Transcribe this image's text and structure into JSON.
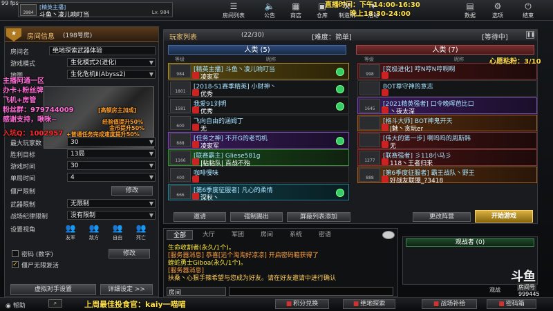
{
  "fps": "99 fps",
  "player": {
    "badge": "3984",
    "tag": "[精英主播]",
    "name": "斗鱼丶凌儿响叮当",
    "level": "Lv. 984"
  },
  "nav": [
    {
      "id": "rooms",
      "label": "房间列表",
      "icon": "☰"
    },
    {
      "id": "notice",
      "label": "公告",
      "icon": "🔈"
    },
    {
      "id": "shop",
      "label": "商店",
      "icon": "▦"
    },
    {
      "id": "depot",
      "label": "仓库",
      "icon": "▣"
    },
    {
      "id": "workshop",
      "label": "制造所",
      "icon": "⚒"
    },
    {
      "id": "event",
      "label": "活动",
      "icon": "✦"
    },
    {
      "id": "data",
      "label": "数据",
      "icon": "▤"
    },
    {
      "id": "options",
      "label": "选项",
      "icon": "⚙"
    },
    {
      "id": "exit",
      "label": "结束",
      "icon": "⏻"
    }
  ],
  "stream_time": {
    "line1": "直播时间：下午14:00-16:30",
    "line2": "晚上18:30-24:00"
  },
  "room": {
    "header": "房间信息",
    "number": "(198号房)",
    "fields": [
      {
        "label": "房间名",
        "value": "绝地探索武器体验"
      },
      {
        "label": "游戏模式",
        "value": "生化模式2(进化)"
      },
      {
        "label": "地图",
        "value": "生化危机Ⅱ(Abyss2)"
      }
    ],
    "settings": [
      {
        "label": "最大玩家数",
        "value": "30"
      },
      {
        "label": "胜利目标",
        "value": "13局"
      },
      {
        "label": "游戏时间",
        "value": "30"
      },
      {
        "label": "单局时间",
        "value": "4"
      },
      {
        "label": "僵尸限制",
        "value": "修改"
      },
      {
        "label": "武器限制",
        "value": "无限制"
      },
      {
        "label": "战场纪律限制",
        "value": "没有限制"
      }
    ],
    "view_label": "设置视角",
    "view_items": [
      "友军",
      "敌方",
      "自由",
      "死亡"
    ],
    "password_label": "密码 (数字)",
    "password_btn": "修改",
    "zombie_label": "僵尸无限复活",
    "btn_virtual": "虚拟对手设置",
    "btn_detail": "详细设定 >>"
  },
  "overlay": {
    "line1": "主播阿通一区",
    "line2": "办卡+粉丝牌",
    "line3": "飞机+房管",
    "line4": "粉丝群：979744009",
    "line5": "感谢支持，啾咪~",
    "qq": "入坑Q：1002957",
    "promo1": "[高额房主加成]",
    "promo2": "经验值提升50%",
    "promo3": "金币提升50%",
    "promo4": "+普通任务完成速度提升50%"
  },
  "players": {
    "title": "玩家列表",
    "count": "(22/30)",
    "difficulty": "[难度：简单]",
    "status": "[等待中]",
    "blue_title": "人类 (5)",
    "red_title": "人类 (7)",
    "col_level": "等级",
    "col_name": "昵称",
    "wish": "心愿粘粉：3/10",
    "blue": [
      {
        "lv": "984",
        "l1": "[精英主播] 斗鱼丶凌儿响叮当",
        "l2": "凌家军",
        "style": "bg-gold",
        "ready": true
      },
      {
        "lv": "1801",
        "l1": "[2018-S1赛季精英] 小财神丶",
        "l2": "优秀",
        "style": "",
        "ready": true
      },
      {
        "lv": "1581",
        "l1": "我爱91刘明",
        "l2": "优秀",
        "style": "",
        "ready": true
      },
      {
        "lv": "600",
        "l1": "飞向自由的涵姆丁",
        "l2": "无",
        "style": "",
        "ready": false
      },
      {
        "lv": "888",
        "l1": "[任务之神] 不开G的老司机",
        "l2": "凌家军",
        "style": "bg-purple",
        "ready": true
      },
      {
        "lv": "1166",
        "l1": "[联赛霸主] Gliese581g",
        "l2": "|粘粘队| 百战不殆",
        "style": "bg-green",
        "ready": false
      },
      {
        "lv": "400",
        "l1": "咖啡慢味",
        "l2": "",
        "style": "",
        "ready": false
      },
      {
        "lv": "666",
        "l1": "[第6季度征服者] 凡心的柔情",
        "l2": "深秋丶",
        "style": "bg-teal",
        "ready": true
      }
    ],
    "red": [
      {
        "lv": "998",
        "l1": "[究极进化] 哼N哼N哼啊啊",
        "l2": "",
        "style": "bg-darkred",
        "ready": false
      },
      {
        "lv": "",
        "l1": "BOT尊守神的意志",
        "l2": "",
        "style": "",
        "ready": false
      },
      {
        "lv": "1645",
        "l1": "[2021精英强者] 口令晚晖芭比口",
        "l2": "丶夜太深",
        "style": "bg-purple",
        "ready": false
      },
      {
        "lv": "",
        "l1": "[格斗大师] BOT神鬼开天",
        "l2": "|魅丶贪玩er",
        "style": "bg-orange",
        "ready": false
      },
      {
        "lv": "",
        "l1": "[伟大的第一步] 啊呜呜的周斯韩",
        "l2": "无",
        "style": "bg-darkred",
        "ready": false
      },
      {
        "lv": "1277",
        "l1": "[联赛强者] 彡118小马彡",
        "l2": "118丶王者归来",
        "style": "bg-darkred",
        "ready": false
      },
      {
        "lv": "888",
        "l1": "[第6季度征服者] 霸王战队丶野王",
        "l2": "好战友联盟_?3418",
        "style": "bg-orange",
        "ready": false
      }
    ],
    "btn_invite": "邀请",
    "btn_kick": "强制踢出",
    "btn_block": "屏蔽列表添加",
    "btn_change": "更改阵营",
    "btn_start": "开始游戏"
  },
  "chat": {
    "tabs": [
      "全部",
      "大厅",
      "军团",
      "房间",
      "系统",
      "密语"
    ],
    "messages": [
      {
        "text": "生命收割者(永久/1个)。",
        "color": "#ffeb3b"
      },
      {
        "text": "[服务器消息] 恭喜[远个淘淘好凉凉] 开启密码箱获得了",
        "color": "#ff9f3b"
      },
      {
        "text": "蝰蛇勇士Giboa(永久/1个)。",
        "color": "#ffeb3b"
      },
      {
        "text": "[服务器消息]",
        "color": "#ff9f3b"
      },
      {
        "text": "扶桑丶心狠手辣希望与您成为好友。请在好友邀请中进行确认",
        "color": "#ffcc55"
      }
    ],
    "input_label": "房间",
    "spectator": "观战者 (0)",
    "logo": "斗鱼",
    "room_tag": "房间号",
    "room_no": "999445",
    "watch_label": "观战"
  },
  "bottom": {
    "help": "帮助",
    "bestfood": "上周最佳投食官：kaiy一喵喵",
    "btn1": "积分兑换",
    "btn2": "绝地探索",
    "btn3": "战场补给",
    "btn4": "密码箱"
  }
}
